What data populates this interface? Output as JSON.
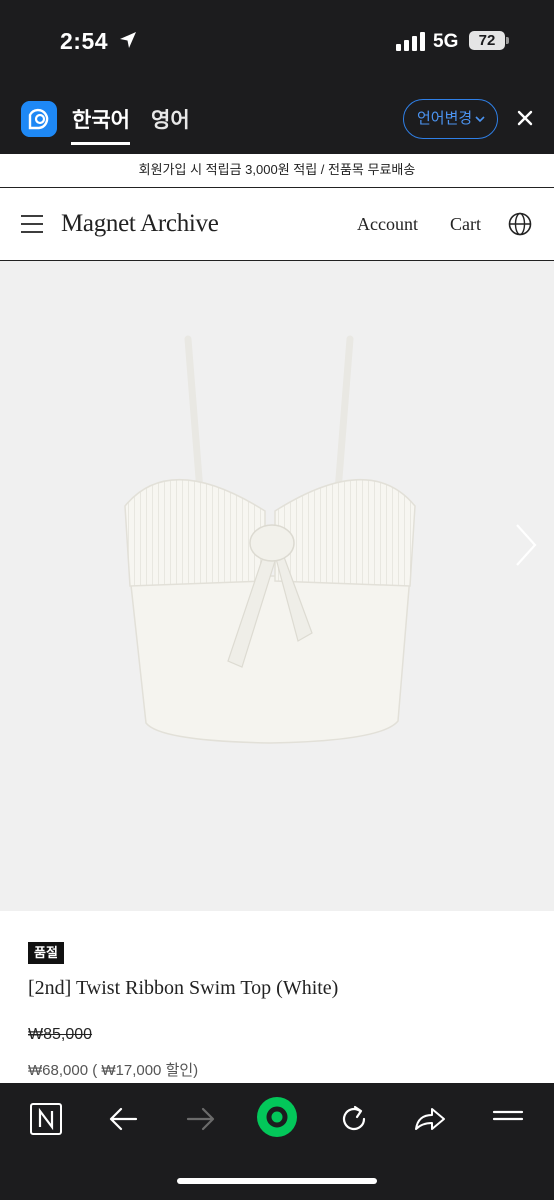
{
  "status_bar": {
    "time": "2:54",
    "network": "5G",
    "battery": "72"
  },
  "translate_bar": {
    "languages": [
      {
        "label": "한국어",
        "active": true
      },
      {
        "label": "영어",
        "active": false
      }
    ],
    "change_language_label": "언어변경",
    "accent_color": "#2f7fe6"
  },
  "promo": {
    "text": "회원가입 시 적립금 3,000원 적립 / 전품목 무료배송"
  },
  "header": {
    "brand": "Magnet Archive",
    "nav": [
      {
        "label": "Account"
      },
      {
        "label": "Cart"
      }
    ]
  },
  "product": {
    "badge": "품절",
    "title": "[2nd] Twist Ribbon Swim Top (White)",
    "original_price": "₩85,000",
    "sale_price": "₩68,000 ( ₩17,000 할인)"
  },
  "toolbar": {
    "icons": [
      "home-n-icon",
      "back-arrow-icon",
      "forward-arrow-icon",
      "green-circle-icon",
      "reload-icon",
      "share-icon",
      "hamburger-menu-icon"
    ],
    "brand_color": "#03c75a"
  }
}
